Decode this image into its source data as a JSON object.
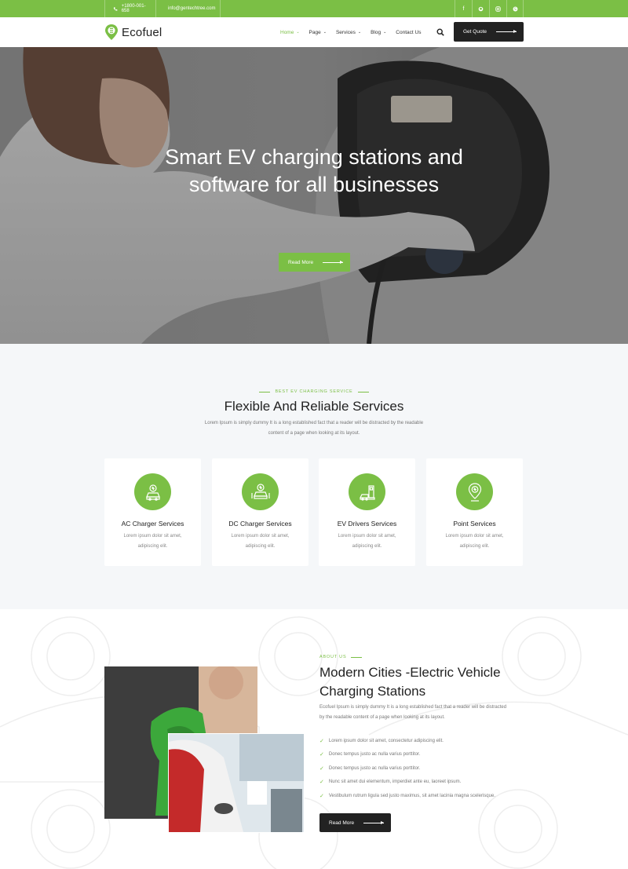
{
  "topbar": {
    "phone": "+1800-001-658",
    "email": "info@gentechtree.com",
    "social_icons": [
      "facebook-icon",
      "github-icon",
      "instagram-icon",
      "skype-icon"
    ]
  },
  "header": {
    "logo_text": "Ecofuel",
    "nav": [
      {
        "label": "Home",
        "active": true,
        "dropdown": true
      },
      {
        "label": "Page",
        "active": false,
        "dropdown": true
      },
      {
        "label": "Services",
        "active": false,
        "dropdown": true
      },
      {
        "label": "Blog",
        "active": false,
        "dropdown": true
      },
      {
        "label": "Contact Us",
        "active": false,
        "dropdown": false
      }
    ],
    "quote_button": "Get Quote"
  },
  "hero": {
    "title_line1": "Smart EV charging stations and",
    "title_line2": "software for all businesses",
    "button": "Read More"
  },
  "services": {
    "eyebrow": "BEST EV CHARGING SERVICE",
    "title": "Flexible And Reliable Services",
    "intro_line1": "Lorem Ipsum is simply dummy It is a long established fact that a reader will be distracted by the readable",
    "intro_line2": "content of a page when looking at its layout.",
    "cards": [
      {
        "title": "AC Charger Services",
        "desc_line1": "Lorem ipsum dolor sit amet,",
        "desc_line2": "adipiscing elit."
      },
      {
        "title": "DC Charger Services",
        "desc_line1": "Lorem ipsum dolor sit amet,",
        "desc_line2": "adipiscing elit."
      },
      {
        "title": "EV Drivers Services",
        "desc_line1": "Lorem ipsum dolor sit amet,",
        "desc_line2": "adipiscing elit."
      },
      {
        "title": "Point Services",
        "desc_line1": "Lorem ipsum dolor sit amet,",
        "desc_line2": "adipiscing elit."
      }
    ]
  },
  "about": {
    "eyebrow": "ABOUT US",
    "title_line1": "Modern Cities -Electric Vehicle",
    "title_line2": "Charging Stations",
    "para_line1": "Ecofuel Ipsum is simply dummy It is a long established fact that a reader will be distracted",
    "para_line2": "by the readable content of a page when looking at its layout.",
    "list": [
      "Lorem ipsum dolor sit amet, consectetur adipiscing elit.",
      "Donec tempus justo ac nulla varius porttitor.",
      "Donec tempus justo ac nulla varius porttitor.",
      "Nunc sit amet dui elementum, imperdiet ante eu, laoreet ipsum.",
      "Vestibulum rutrum ligula sed justo maximus, sit amet lacinia magna scelerisque."
    ],
    "button": "Read More"
  },
  "colors": {
    "accent": "#7bbf45",
    "dark": "#222222",
    "bg_light": "#f5f7f9"
  }
}
